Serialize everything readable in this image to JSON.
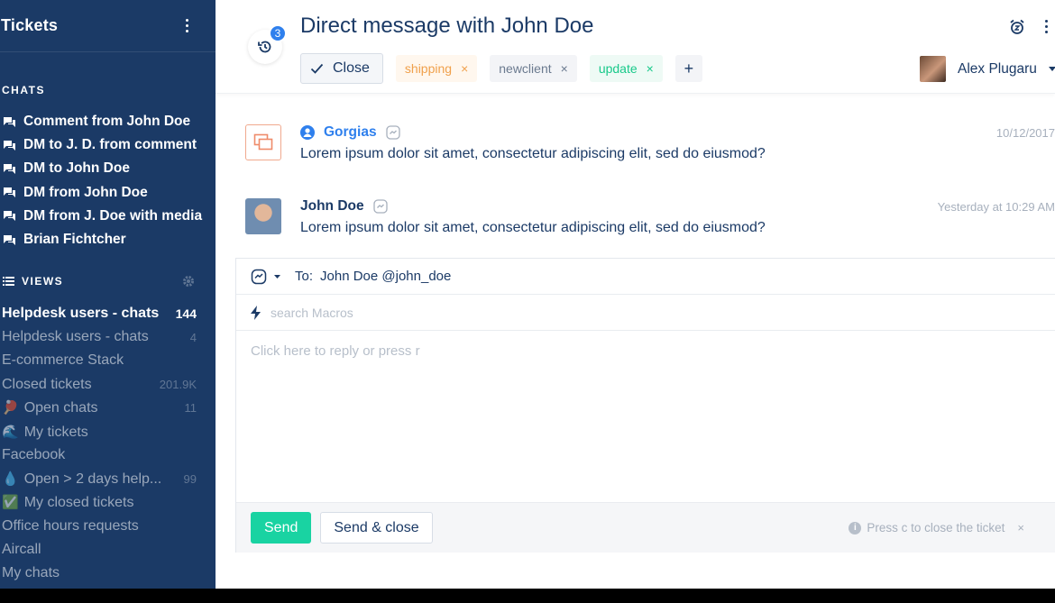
{
  "sidebar": {
    "title": "Tickets",
    "chats_label": "CHATS",
    "chats": [
      {
        "label": "Comment from John Doe"
      },
      {
        "label": "DM to J. D. from comment"
      },
      {
        "label": "DM to John Doe"
      },
      {
        "label": "DM from John Doe"
      },
      {
        "label": "DM from J. Doe with media"
      },
      {
        "label": "Brian Fichtcher"
      }
    ],
    "views_label": "VIEWS",
    "views": [
      {
        "emoji": "",
        "label": "Helpdesk users - chats",
        "count": "144",
        "active": true
      },
      {
        "emoji": "",
        "label": "Helpdesk users - chats",
        "count": "4"
      },
      {
        "emoji": "",
        "label": "E-commerce Stack",
        "count": ""
      },
      {
        "emoji": "",
        "label": "Closed tickets",
        "count": "201.9K"
      },
      {
        "emoji": "🏓",
        "label": "Open chats",
        "count": "11"
      },
      {
        "emoji": "🌊",
        "label": "My tickets",
        "count": ""
      },
      {
        "emoji": "",
        "label": "Facebook",
        "count": ""
      },
      {
        "emoji": "💧",
        "label": "Open > 2 days help...",
        "count": "99"
      },
      {
        "emoji": "✅",
        "label": "My closed tickets",
        "count": ""
      },
      {
        "emoji": "",
        "label": "Office hours requests",
        "count": ""
      },
      {
        "emoji": "",
        "label": "Aircall",
        "count": ""
      },
      {
        "emoji": "",
        "label": "My chats",
        "count": ""
      }
    ]
  },
  "header": {
    "history_count": "3",
    "subject": "Direct message with John Doe",
    "close_label": "Close",
    "tags": [
      {
        "label": "shipping",
        "remove": "×"
      },
      {
        "label": "newclient",
        "remove": "×"
      },
      {
        "label": "update",
        "remove": "×"
      }
    ],
    "add_tag": "+",
    "assignee": "Alex Plugaru"
  },
  "messages": [
    {
      "sender": "Gorgias",
      "time": "10/12/2017",
      "body": "Lorem ipsum dolor sit amet, consectetur adipiscing elit, sed do eiusmod?"
    },
    {
      "sender": "John Doe",
      "time": "Yesterday at 10:29 AM",
      "body": "Lorem ipsum dolor sit amet, consectetur adipiscing elit, sed do eiusmod?"
    }
  ],
  "composer": {
    "to_label": "To:",
    "to_value": "John Doe @john_doe",
    "macro_placeholder": "search Macros",
    "reply_placeholder": "Click here to reply or press r",
    "send_label": "Send",
    "send_close_label": "Send & close",
    "hint": "Press c to close the ticket",
    "hint_info": "i",
    "hint_close": "×"
  },
  "colors": {
    "sidebar_bg": "#1b3a66",
    "accent_blue": "#2f80ed",
    "send_green": "#19d3a2",
    "tag_shipping": "#f0a04b",
    "tag_update": "#18c98a"
  }
}
